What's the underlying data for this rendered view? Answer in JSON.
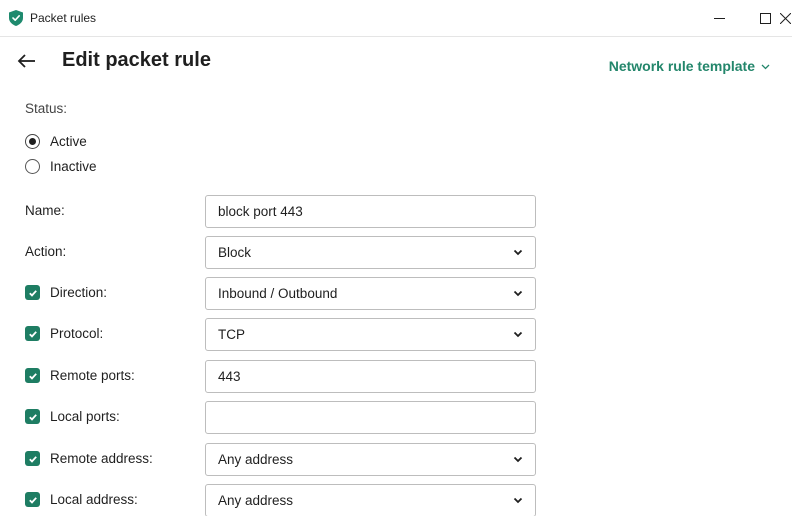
{
  "window": {
    "title": "Packet rules",
    "controls": {
      "minimize": "minimize",
      "maximize": "maximize",
      "close": "close"
    }
  },
  "header": {
    "title": "Edit packet rule",
    "template_link": "Network rule template"
  },
  "status": {
    "label": "Status:",
    "options": [
      {
        "label": "Active",
        "checked": true
      },
      {
        "label": "Inactive",
        "checked": false
      }
    ]
  },
  "form": {
    "name": {
      "label": "Name:",
      "value": "block port 443"
    },
    "action": {
      "label": "Action:",
      "value": "Block"
    },
    "direction": {
      "label": "Direction:",
      "value": "Inbound / Outbound",
      "enabled": true
    },
    "protocol": {
      "label": "Protocol:",
      "value": "TCP",
      "enabled": true
    },
    "remote_ports": {
      "label": "Remote ports:",
      "value": "443",
      "enabled": true
    },
    "local_ports": {
      "label": "Local ports:",
      "value": "",
      "enabled": true
    },
    "remote_address": {
      "label": "Remote address:",
      "value": "Any address",
      "enabled": true
    },
    "local_address": {
      "label": "Local address:",
      "value": "Any address",
      "enabled": true
    }
  },
  "colors": {
    "accent": "#23866b",
    "checkbox": "#1e7d63",
    "border": "#bdbdbd"
  }
}
